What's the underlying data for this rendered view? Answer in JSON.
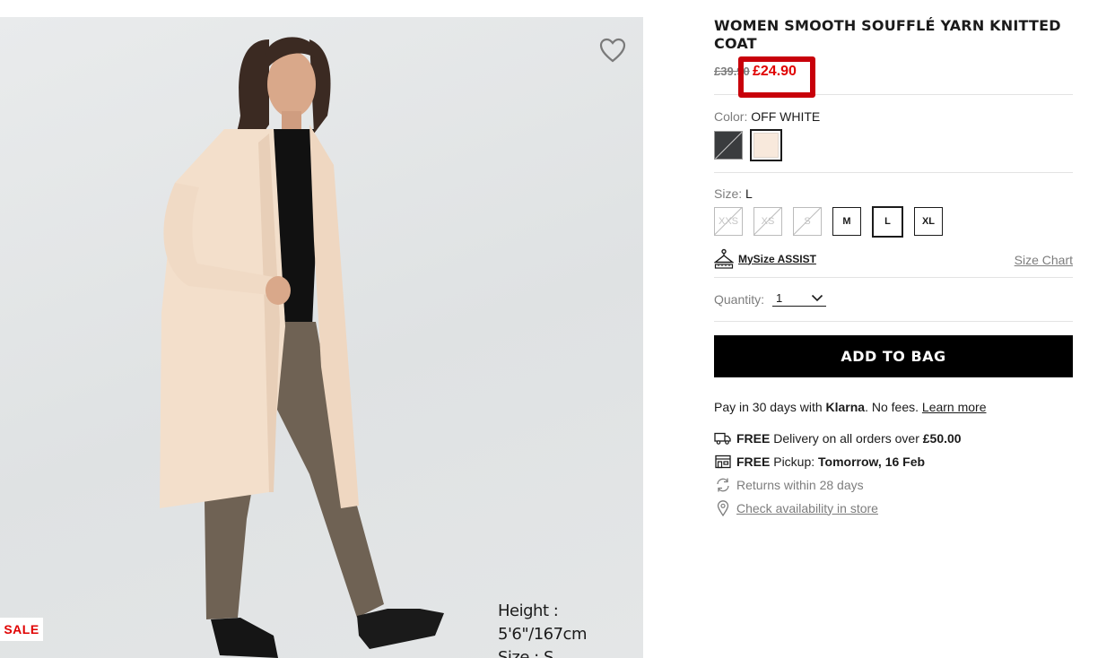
{
  "product": {
    "title": "WOMEN SMOOTH SOUFFLÉ YARN KNITTED COAT",
    "old_price": "£39.90",
    "sale_price": "£24.90"
  },
  "image": {
    "badge": "SALE",
    "model_height": "Height : 5'6\"/167cm",
    "model_size": "Size : S",
    "wishlist_icon": "heart-icon"
  },
  "color": {
    "label": "Color:",
    "selected": "OFF WHITE",
    "options": [
      {
        "name": "dark-gray",
        "hex": "#3a3c3e",
        "available": false
      },
      {
        "name": "off-white",
        "hex": "#f8e9dc",
        "available": true
      }
    ]
  },
  "size": {
    "label": "Size:",
    "selected": "L",
    "options": [
      {
        "label": "XXS",
        "available": false
      },
      {
        "label": "XS",
        "available": false
      },
      {
        "label": "S",
        "available": false
      },
      {
        "label": "M",
        "available": true
      },
      {
        "label": "L",
        "available": true
      },
      {
        "label": "XL",
        "available": true
      }
    ],
    "mysize_label": "MySize ASSIST",
    "size_chart_label": "Size Chart"
  },
  "quantity": {
    "label": "Quantity:",
    "value": "1"
  },
  "actions": {
    "add_to_bag": "ADD TO BAG"
  },
  "klarna": {
    "prefix": "Pay in 30 days with ",
    "brand": "Klarna",
    "suffix": ". No fees. ",
    "link": "Learn more"
  },
  "info": {
    "delivery_bold": "FREE",
    "delivery_text": " Delivery on all orders over ",
    "delivery_amount": "£50.00",
    "pickup_bold": "FREE",
    "pickup_text": " Pickup: ",
    "pickup_date": "Tomorrow, 16 Feb",
    "returns": "Returns within 28 days",
    "availability": "Check availability in store"
  },
  "colors": {
    "sale_red": "#e00000",
    "highlight_border": "#c8000a",
    "button_black": "#000000"
  }
}
